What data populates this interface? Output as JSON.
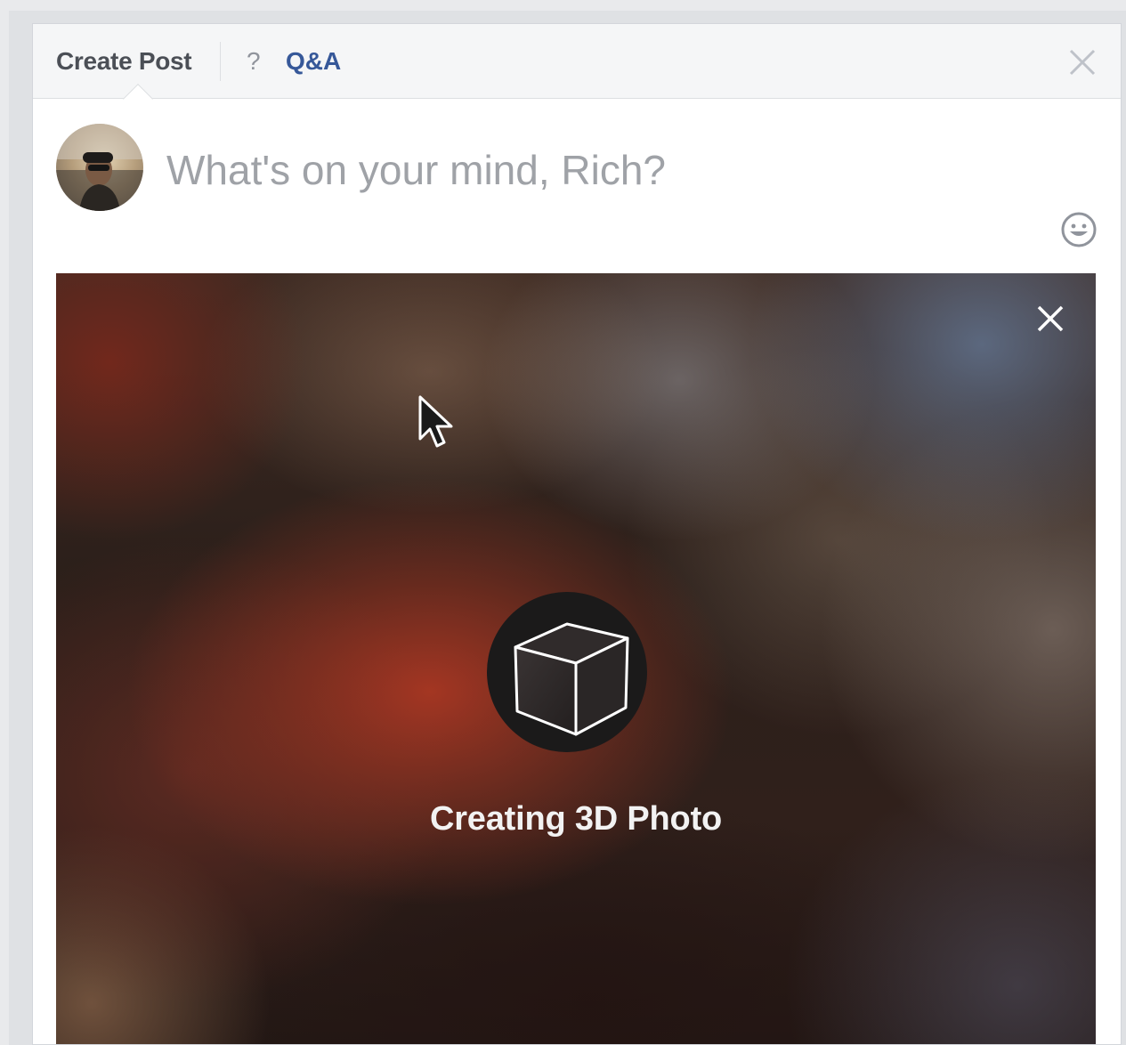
{
  "header": {
    "create_post_tab": "Create Post",
    "qa_icon": "?",
    "qa_tab": "Q&A",
    "close_icon": "close-icon"
  },
  "composer": {
    "placeholder": "What's on your mind, Rich?",
    "avatar_icon": "avatar",
    "emoji_icon": "emoji-icon"
  },
  "media": {
    "close_icon": "close-icon",
    "status_icon": "cube-icon",
    "status_text": "Creating 3D Photo"
  },
  "colors": {
    "header_bg": "#f5f6f7",
    "tab_text": "#4b4f56",
    "link_blue": "#365899",
    "placeholder": "#9fa2a7"
  }
}
